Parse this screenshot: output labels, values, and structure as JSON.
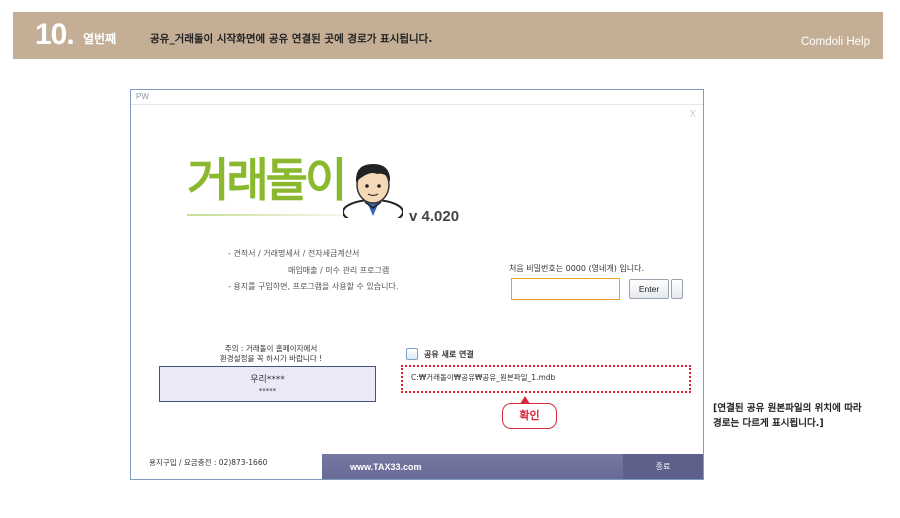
{
  "banner": {
    "step_number": "10.",
    "step_word": "열번째",
    "title": "공유_거래돌이 시작화면에 공유 연결된 곳에 경로가 표시됩니다.",
    "help": "Comdoli Help"
  },
  "window": {
    "title": "PW",
    "close_glyph": "X",
    "logo_text": "거래돌이",
    "version": "v 4.020",
    "desc_lines": [
      "- 견적서 / 거래명세서 / 전자세금계산서",
      "매입매출 / 미수 관리 프로그램",
      "- 용지를 구입하면, 프로그램을 사용할 수 있습니다."
    ],
    "password_hint": "처음 비밀번호는 0000 (영네개) 입니다.",
    "password_value": "",
    "enter_label": "Enter",
    "notice_lines": [
      "주의 : 거래돌이 홈페이지에서",
      "환경설정을 꼭 하시기 바랍니다 !"
    ],
    "user_line1": "우리****",
    "user_line2": "*****",
    "share_checkbox_label": "공유 새로 연결",
    "share_path": "C:₩거래돌이₩공유₩공유_원본파일_1.mdb",
    "footer_text": "용지구입 / 요금충전 : 02)873-1660",
    "url": "www.TAX33.com",
    "exit_label": "종료"
  },
  "callout": "확인",
  "side_note_lines": [
    "[연결된 공유 원본파일의 위치에 따라",
    "경로는 다르게 표시됩니다.]"
  ]
}
